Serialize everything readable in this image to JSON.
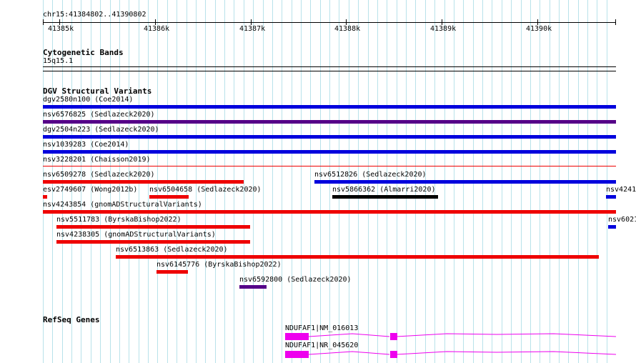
{
  "ruler": {
    "region": "chr15:41384802..41390802",
    "ticks": [
      "41385k",
      "41386k",
      "41387k",
      "41388k",
      "41389k",
      "41390k"
    ]
  },
  "cyto": {
    "title": "Cytogenetic Bands",
    "band": "15q15.1"
  },
  "dgv": {
    "title": "DGV Structural Variants",
    "features": [
      {
        "label": "dgv2580n100 (Coe2014)",
        "color": "#0000dd"
      },
      {
        "label": "nsv6576825 (Sedlazeck2020)",
        "color": "#550088"
      },
      {
        "label": "dgv2504n223 (Sedlazeck2020)",
        "color": "#0000dd"
      },
      {
        "label": "nsv1039283 (Coe2014)",
        "color": "#0000dd"
      },
      {
        "label": "nsv3228201 (Chaisson2019)",
        "color": "#ee0000"
      },
      {
        "label": "nsv6509278 (Sedlazeck2020)",
        "color": "#ee0000"
      },
      {
        "label": "nsv6512826 (Sedlazeck2020)",
        "color": "#0000dd"
      },
      {
        "label": "esv2749607 (Wong2012b)",
        "color": "#ee0000"
      },
      {
        "label": "nsv6504658 (Sedlazeck2020)",
        "color": "#ee0000"
      },
      {
        "label": "nsv5866362 (Almarri2020)",
        "color": "#000000"
      },
      {
        "label": "nsv4241",
        "color": "#0000dd"
      },
      {
        "label": "nsv4243854 (gnomADStructuralVariants)",
        "color": "#ee0000"
      },
      {
        "label": "nsv5511783 (ByrskaBishop2022)",
        "color": "#ee0000"
      },
      {
        "label": "nsv6021",
        "color": "#0000dd"
      },
      {
        "label": "nsv4238305 (gnomADStructuralVariants)",
        "color": "#ee0000"
      },
      {
        "label": "nsv6513863 (Sedlazeck2020)",
        "color": "#ee0000"
      },
      {
        "label": "nsv6145776 (ByrskaBishop2022)",
        "color": "#ee0000"
      },
      {
        "label": "nsv6592800 (Sedlazeck2020)",
        "color": "#550088"
      }
    ]
  },
  "genes": {
    "title": "RefSeq Genes",
    "color": "#ee00ee",
    "features": [
      {
        "label": "NDUFAF1|NM_016013"
      },
      {
        "label": "NDUFAF1|NR_045620"
      }
    ]
  }
}
